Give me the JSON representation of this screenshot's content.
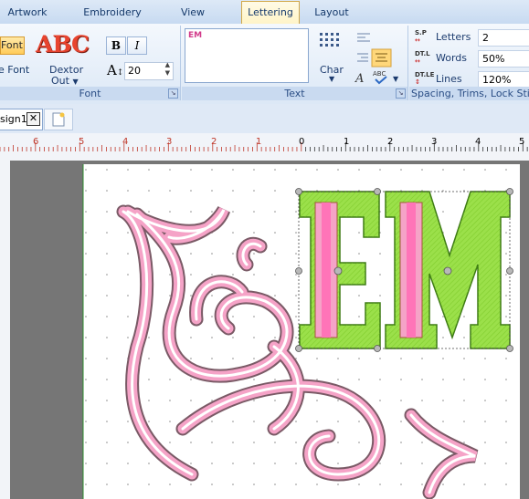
{
  "tabs": [
    "Artwork",
    "Embroidery",
    "View",
    "Lettering",
    "Layout"
  ],
  "active_tab": "Lettering",
  "ribbon": {
    "font_group": {
      "font_button": "Font",
      "font_sub": "e Font",
      "style_name": "Dextor",
      "style_sub": "Out",
      "preview_text": "ABC",
      "bold": "B",
      "italic": "I",
      "size_label": "A",
      "size_value": "20",
      "label": "Font"
    },
    "text_group": {
      "text_value": "EM",
      "char_label": "Char",
      "label": "Text"
    },
    "spacing_group": {
      "label": "Spacing, Trims, Lock Stitc",
      "rows": [
        {
          "icon": "S.P",
          "label": "Letters",
          "value": "2"
        },
        {
          "icon": "DT.L",
          "label": "Words",
          "value": "50%"
        },
        {
          "icon": "DT.LE",
          "label": "Lines",
          "value": "120%"
        }
      ]
    }
  },
  "document": {
    "tab_label": "sign1",
    "close_icon": "close-icon",
    "new_icon": "new-document-icon"
  },
  "ruler": {
    "labels": [
      "6",
      "5",
      "4",
      "3",
      "2",
      "1",
      "0",
      "1",
      "2",
      "3",
      "4",
      "5"
    ]
  },
  "colors": {
    "accent_tab": "#fff4c8",
    "ribbon_bg": "#dce8f6",
    "letter_fill": "#9be04a",
    "satin_pink": "#f5a3c7",
    "hoop_gray": "#767676"
  }
}
